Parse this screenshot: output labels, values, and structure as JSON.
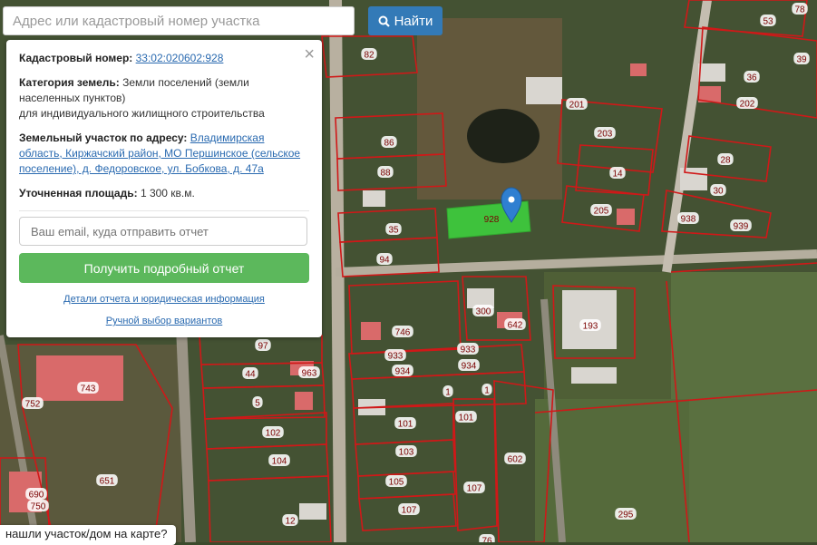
{
  "search": {
    "placeholder": "Адрес или кадастровый номер участка",
    "button_label": "Найти"
  },
  "info": {
    "cadastral_label": "Кадастровый номер:",
    "cadastral_number": "33:02:020602:928",
    "category_label": "Категория земель:",
    "category_value": "Земли поселений (земли населенных пунктов)",
    "category_use": "для индивидуального жилищного строительства",
    "address_label": "Земельный участок по адресу:",
    "address_value": "Владимирская область, Киржачский район, МО Першинское (сельское поселение), д. Федоровское, ул. Бобкова, д. 47а",
    "area_label": "Уточненная площадь:",
    "area_value": "1 300 кв.м.",
    "email_placeholder": "Ваш email, куда отправить отчет",
    "report_button": "Получить подробный отчет",
    "details_link": "Детали отчета и юридическая информация",
    "manual_link": "Ручной выбор вариантов"
  },
  "bottom_hint": "нашли участок/дом на карте?",
  "map": {
    "colors": {
      "parcel_border": "#d01818",
      "selected_fill": "#3ed63e",
      "marker": "#2f7fd1"
    },
    "selected_parcel": "928",
    "parcel_labels": [
      "82",
      "53",
      "78",
      "39",
      "36",
      "201",
      "202",
      "86",
      "203",
      "88",
      "14",
      "28",
      "30",
      "205",
      "938",
      "939",
      "35",
      "94",
      "300",
      "642",
      "193",
      "746",
      "933",
      "97",
      "963",
      "934",
      "44",
      "5",
      "1",
      "743",
      "752",
      "101",
      "102",
      "104",
      "103",
      "602",
      "690",
      "750",
      "651",
      "105",
      "107",
      "12",
      "295",
      "76"
    ]
  }
}
